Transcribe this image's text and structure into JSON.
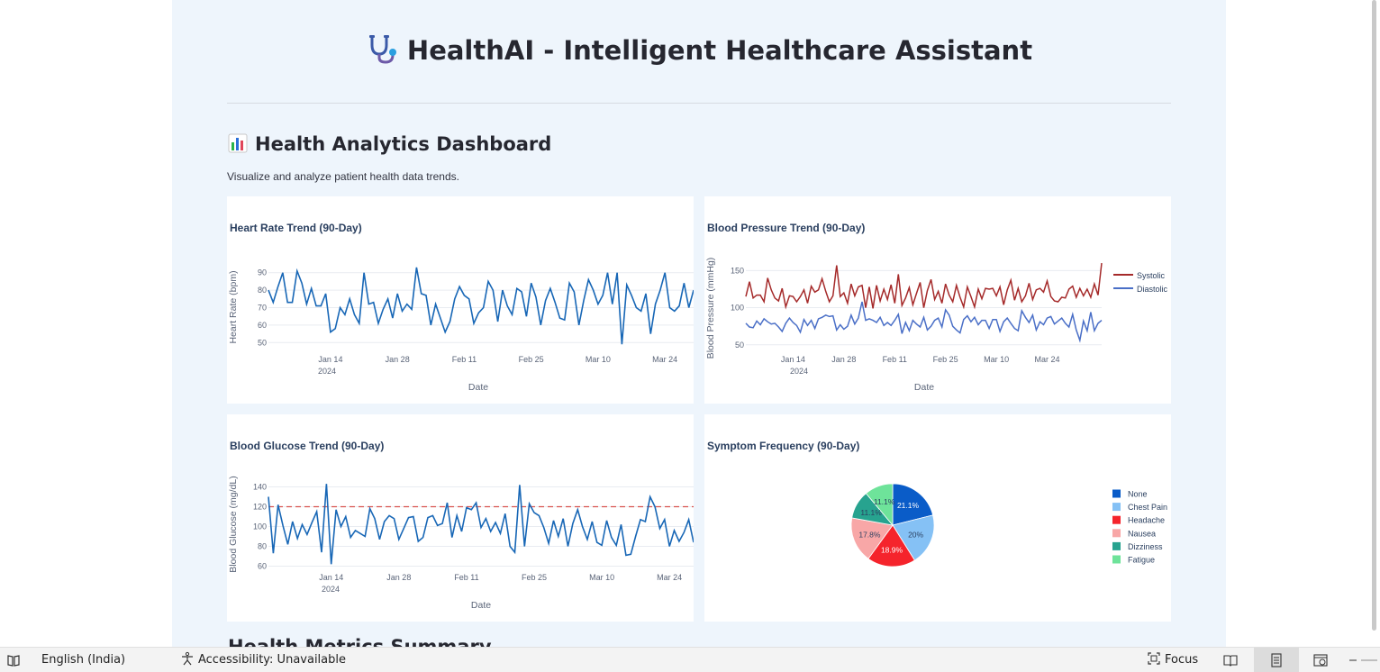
{
  "app": {
    "title": "HealthAI - Intelligent Healthcare Assistant",
    "title_icon": "stethoscope-icon",
    "section_icon": "bar-chart-icon",
    "section_title": "Health Analytics Dashboard",
    "section_caption": "Visualize and analyze patient health data trends.",
    "next_section_title": "Health Metrics Summary"
  },
  "colors": {
    "blue": "#1867b6",
    "red_line": "#a52a2a",
    "diastolic": "#4a6fc7",
    "threshold": "#d9534f",
    "pie": [
      "#0a5cc8",
      "#85c1f5",
      "#f5242c",
      "#f8a7a7",
      "#27a38f",
      "#6ee39a"
    ]
  },
  "charts": {
    "heart_rate": {
      "title": "Heart Rate Trend (90-Day)",
      "ylabel": "Heart Rate (bpm)",
      "xlabel": "Date",
      "year_label": "2024",
      "xticks": [
        "Jan 14",
        "Jan 28",
        "Feb 11",
        "Feb 25",
        "Mar 10",
        "Mar 24"
      ],
      "yticks": [
        "50",
        "60",
        "70",
        "80",
        "90"
      ]
    },
    "blood_pressure": {
      "title": "Blood Pressure Trend (90-Day)",
      "ylabel": "Blood Pressure (mmHg)",
      "xlabel": "Date",
      "year_label": "2024",
      "xticks": [
        "Jan 14",
        "Jan 28",
        "Feb 11",
        "Feb 25",
        "Mar 10",
        "Mar 24"
      ],
      "yticks": [
        "50",
        "100",
        "150"
      ],
      "legend": [
        "Systolic",
        "Diastolic"
      ]
    },
    "glucose": {
      "title": "Blood Glucose Trend (90-Day)",
      "ylabel": "Blood Glucose (mg/dL)",
      "xlabel": "Date",
      "year_label": "2024",
      "xticks": [
        "Jan 14",
        "Jan 28",
        "Feb 11",
        "Feb 25",
        "Mar 10",
        "Mar 24"
      ],
      "yticks": [
        "60",
        "80",
        "100",
        "120",
        "140"
      ]
    },
    "symptoms": {
      "title": "Symptom Frequency (90-Day)",
      "slice_labels": [
        "21.1%",
        "20%",
        "18.9%",
        "17.8%",
        "11.1%",
        "11.1%"
      ]
    }
  },
  "chart_data": [
    {
      "type": "line",
      "title": "Heart Rate Trend (90-Day)",
      "xlabel": "Date",
      "ylabel": "Heart Rate (bpm)",
      "x_start": "2024-01-01",
      "x_end": "2024-03-30",
      "ylim": [
        45,
        95
      ],
      "series": [
        {
          "name": "Heart Rate",
          "values": [
            80,
            73,
            82,
            90,
            73,
            73,
            91,
            84,
            72,
            81,
            71,
            71,
            78,
            56,
            58,
            70,
            66,
            75,
            66,
            61,
            90,
            72,
            73,
            61,
            69,
            75,
            64,
            78,
            68,
            72,
            69,
            93,
            78,
            77,
            60,
            72,
            64,
            56,
            62,
            75,
            82,
            77,
            75,
            61,
            67,
            70,
            85,
            80,
            62,
            80,
            71,
            66,
            81,
            79,
            65,
            84,
            76,
            60,
            74,
            81,
            73,
            64,
            63,
            84,
            79,
            60,
            74,
            86,
            80,
            72,
            77,
            90,
            72,
            90,
            49,
            83,
            77,
            70,
            68,
            78,
            55,
            72,
            80,
            90,
            70,
            68,
            71,
            84,
            70,
            80
          ]
        }
      ]
    },
    {
      "type": "line",
      "title": "Blood Pressure Trend (90-Day)",
      "xlabel": "Date",
      "ylabel": "Blood Pressure (mmHg)",
      "x_start": "2024-01-01",
      "x_end": "2024-03-30",
      "ylim": [
        40,
        165
      ],
      "series": [
        {
          "name": "Systolic",
          "values": [
            115,
            135,
            113,
            117,
            117,
            108,
            140,
            124,
            113,
            109,
            126,
            101,
            116,
            115,
            108,
            115,
            124,
            106,
            129,
            121,
            124,
            139,
            122,
            108,
            116,
            157,
            115,
            120,
            106,
            132,
            116,
            128,
            130,
            100,
            128,
            99,
            130,
            109,
            125,
            111,
            131,
            106,
            145,
            103,
            113,
            127,
            104,
            119,
            134,
            100,
            123,
            138,
            111,
            122,
            106,
            132,
            117,
            108,
            130,
            114,
            101,
            128,
            115,
            101,
            125,
            112,
            126,
            125,
            126,
            116,
            128,
            104,
            124,
            137,
            110,
            126,
            108,
            116,
            133,
            111,
            124,
            126,
            121,
            136,
            115,
            109,
            108,
            114,
            113,
            125,
            129,
            114,
            126,
            116,
            125,
            114,
            132,
            117,
            160
          ]
        },
        {
          "name": "Diastolic",
          "values": [
            79,
            74,
            73,
            82,
            77,
            85,
            81,
            78,
            79,
            74,
            68,
            79,
            86,
            80,
            76,
            67,
            84,
            76,
            83,
            72,
            85,
            87,
            90,
            88,
            89,
            70,
            77,
            71,
            75,
            90,
            78,
            86,
            108,
            83,
            85,
            83,
            80,
            87,
            76,
            80,
            76,
            83,
            91,
            65,
            80,
            69,
            83,
            78,
            74,
            87,
            70,
            75,
            83,
            86,
            74,
            97,
            90,
            75,
            70,
            66,
            84,
            89,
            81,
            87,
            77,
            83,
            83,
            72,
            84,
            84,
            68,
            81,
            86,
            79,
            72,
            69,
            96,
            87,
            80,
            90,
            70,
            81,
            77,
            86,
            88,
            78,
            82,
            86,
            79,
            74,
            91,
            70,
            56,
            82,
            69,
            94,
            69,
            79,
            83
          ]
        }
      ]
    },
    {
      "type": "line",
      "title": "Blood Glucose Trend (90-Day)",
      "xlabel": "Date",
      "ylabel": "Blood Glucose (mg/dL)",
      "x_start": "2024-01-01",
      "x_end": "2024-03-30",
      "ylim": [
        55,
        145
      ],
      "threshold": 120,
      "series": [
        {
          "name": "Blood Glucose",
          "values": [
            130,
            73,
            122,
            101,
            82,
            105,
            88,
            102,
            92,
            104,
            115,
            74,
            143,
            62,
            117,
            100,
            110,
            89,
            96,
            93,
            90,
            118,
            108,
            87,
            105,
            111,
            108,
            87,
            98,
            109,
            110,
            85,
            89,
            109,
            111,
            101,
            103,
            124,
            89,
            111,
            95,
            119,
            117,
            124,
            99,
            108,
            95,
            104,
            93,
            113,
            80,
            74,
            142,
            80,
            123,
            114,
            111,
            99,
            83,
            106,
            90,
            108,
            80,
            103,
            117,
            100,
            87,
            105,
            84,
            81,
            106,
            89,
            81,
            102,
            71,
            72,
            90,
            107,
            105,
            130,
            120,
            98,
            107,
            80,
            96,
            85,
            94,
            107,
            84
          ]
        }
      ]
    },
    {
      "type": "pie",
      "title": "Symptom Frequency (90-Day)",
      "categories": [
        "None",
        "Chest Pain",
        "Headache",
        "Nausea",
        "Dizziness",
        "Fatigue"
      ],
      "legend_order": [
        "None",
        "Chest Pain",
        "Headache",
        "Nausea",
        "Dizziness",
        "Fatigue"
      ],
      "slice_order": [
        "None",
        "Chest Pain",
        "Headache",
        "Nausea",
        "Dizziness",
        "Fatigue"
      ],
      "values": [
        21.1,
        20.0,
        18.9,
        17.8,
        11.1,
        11.1
      ],
      "legend_placement": "right"
    }
  ],
  "statusbar": {
    "language": "English (India)",
    "accessibility": "Accessibility: Unavailable",
    "focus": "Focus"
  }
}
